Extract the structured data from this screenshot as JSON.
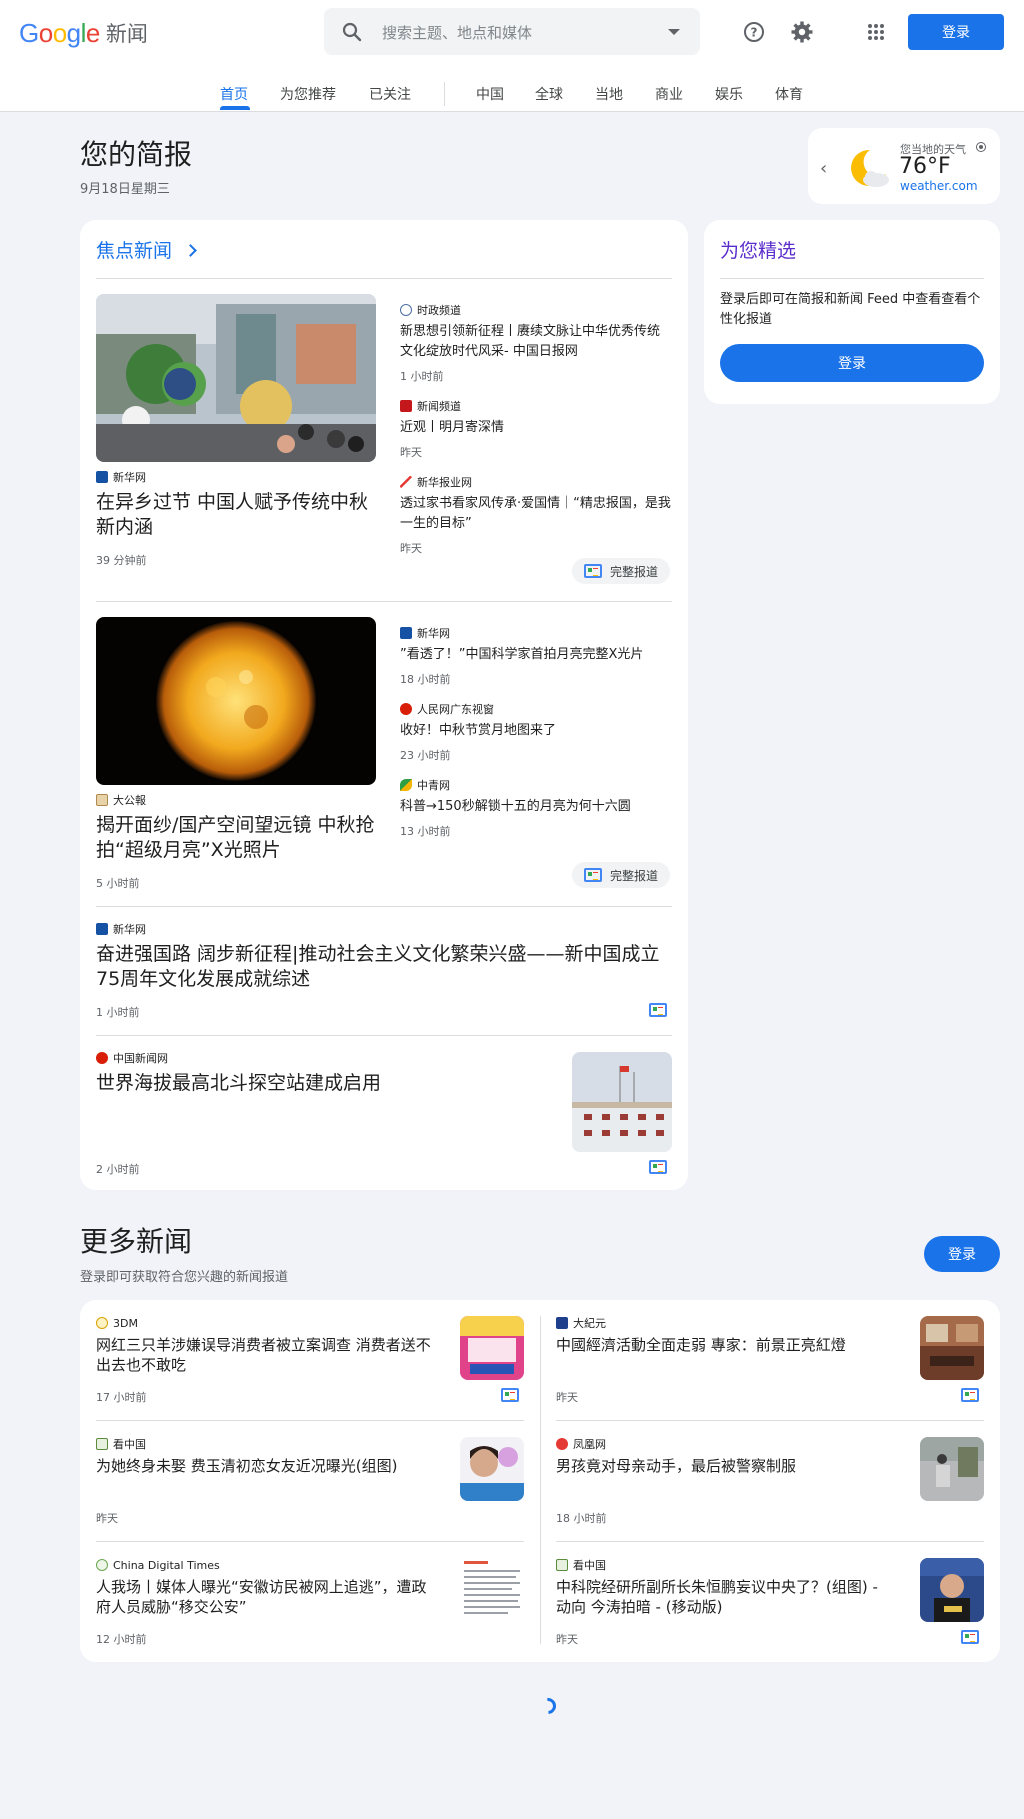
{
  "header": {
    "logo_google": "Google",
    "logo_news": "新闻",
    "search_placeholder": "搜索主题、地点和媒体",
    "signin": "登录"
  },
  "nav": {
    "items": [
      "首页",
      "为您推荐",
      "已关注",
      "中国",
      "全球",
      "当地",
      "商业",
      "娱乐",
      "体育"
    ]
  },
  "briefing": {
    "title": "您的简报",
    "date": "9月18日星期三"
  },
  "weather": {
    "label": "您当地的天气",
    "temp": "76°F",
    "source": "weather.com"
  },
  "top_stories": {
    "title": "焦点新闻",
    "full_coverage": "完整报道",
    "cluster1": {
      "lead": {
        "source": "新华网",
        "title": "在异乡过节 中国人赋予传统中秋新内涵",
        "time": "39 分钟前"
      },
      "related": [
        {
          "source": "时政频道",
          "title": "新思想引领新征程丨赓续文脉让中华优秀传统文化绽放时代风采- 中国日报网",
          "time": "1 小时前"
        },
        {
          "source": "新闻频道",
          "title": "近观丨明月寄深情",
          "time": "昨天"
        },
        {
          "source": "新华报业网",
          "title": "透过家书看家风传承·爱国情｜“精忠报国，是我一生的目标”",
          "time": "昨天"
        }
      ]
    },
    "cluster2": {
      "lead": {
        "source": "大公報",
        "title": "揭开面纱/国产空间望远镜 中秋抢拍“超级月亮”X光照片",
        "time": "5 小时前"
      },
      "related": [
        {
          "source": "新华网",
          "title": "”看透了！”中国科学家首拍月亮完整X光片",
          "time": "18 小时前"
        },
        {
          "source": "人民网广东视窗",
          "title": "收好！中秋节赏月地图来了",
          "time": "23 小时前"
        },
        {
          "source": "中青网",
          "title": "科普→150秒解锁十五的月亮为何十六圆",
          "time": "13 小时前"
        }
      ]
    },
    "single1": {
      "source": "新华网",
      "title": "奋进强国路 阔步新征程|推动社会主义文化繁荣兴盛——新中国成立75周年文化发展成就综述",
      "time": "1 小时前"
    },
    "single2": {
      "source": "中国新闻网",
      "title": "世界海拔最高北斗探空站建成启用",
      "time": "2 小时前"
    }
  },
  "picks": {
    "title": "为您精选",
    "text": "登录后即可在简报和新闻 Feed 中查看查看个性化报道",
    "signin": "登录"
  },
  "more": {
    "title": "更多新闻",
    "subtitle": "登录即可获取符合您兴趣的新闻报道",
    "signin": "登录",
    "items": [
      {
        "source": "3DM",
        "title": "网红三只羊涉嫌误导消费者被立案调查 消费者送不出去也不敢吃",
        "time": "17 小时前"
      },
      {
        "source": "大紀元",
        "title": "中國經濟活動全面走弱 專家：前景正亮紅燈",
        "time": "昨天"
      },
      {
        "source": "看中国",
        "title": "为她终身未娶 费玉清初恋女友近况曝光(组图)",
        "time": "昨天"
      },
      {
        "source": "凤凰网",
        "title": "男孩竟对母亲动手，最后被警察制服",
        "time": "18 小时前"
      },
      {
        "source": "China Digital Times",
        "title": "人我场丨媒体人曝光“安徽访民被网上追逃”，遭政府人员威胁“移交公安”",
        "time": "12 小时前"
      },
      {
        "source": "看中国",
        "title": "中科院经研所副所长朱恒鹏妄议中央了？(组图) - 动向 今涛拍暗 - (移动版)",
        "time": "昨天"
      }
    ]
  },
  "colors": {
    "accent": "#1a73e8",
    "picks_title": "#5b2ecc",
    "page_bg": "#f1f3f8"
  }
}
